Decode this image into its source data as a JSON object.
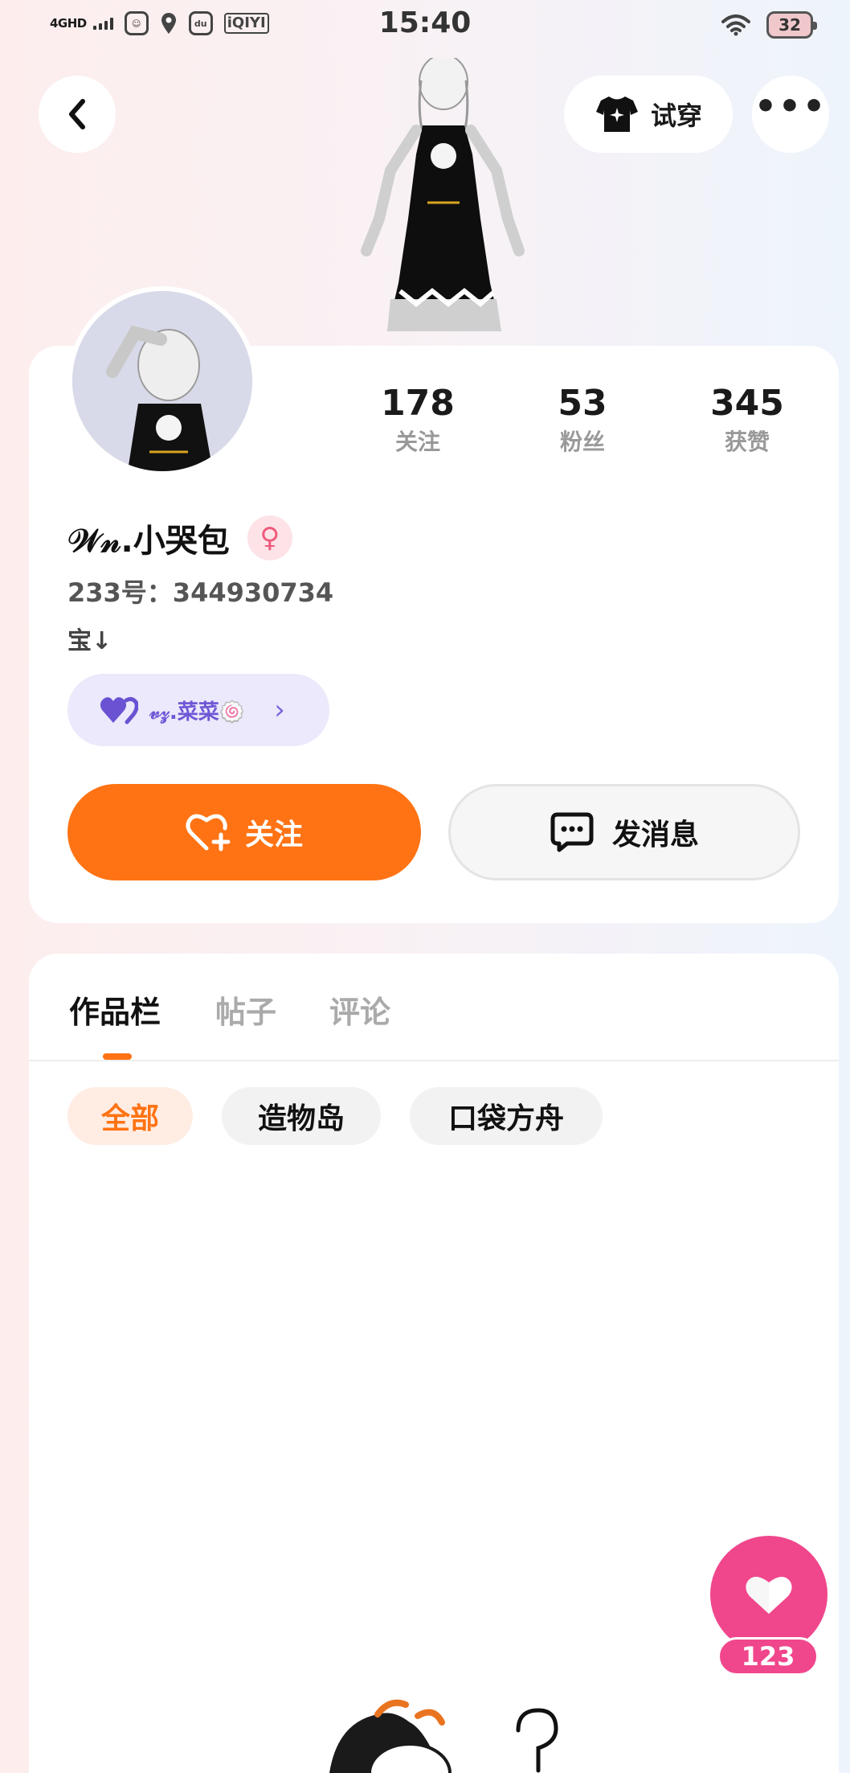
{
  "status_bar": {
    "network": "4GHD",
    "app_icons": [
      "du",
      "du"
    ],
    "iqiyi": "iQIYI",
    "time": "15:40",
    "battery": "32"
  },
  "header": {
    "try_on_label": "试穿",
    "more_label": "•••"
  },
  "profile": {
    "stats": [
      {
        "value": "178",
        "label": "关注"
      },
      {
        "value": "53",
        "label": "粉丝"
      },
      {
        "value": "345",
        "label": "获赞"
      }
    ],
    "name": "𝒲𝓃.小哭包",
    "gender_symbol": "♀",
    "id_text": "233号：344930734",
    "bio": "宝↓",
    "bond": {
      "name": "𝓋𝓏.菜菜🍥"
    },
    "follow_label": "关注",
    "message_label": "发消息"
  },
  "works": {
    "tabs": [
      "作品栏",
      "帖子",
      "评论"
    ],
    "filters": [
      "全部",
      "造物岛",
      "口袋方舟"
    ]
  },
  "floating_like": {
    "count": "123"
  },
  "colors": {
    "accent": "#ff7314",
    "like_pink": "#f0468c",
    "bond_purple": "#7057d6"
  }
}
